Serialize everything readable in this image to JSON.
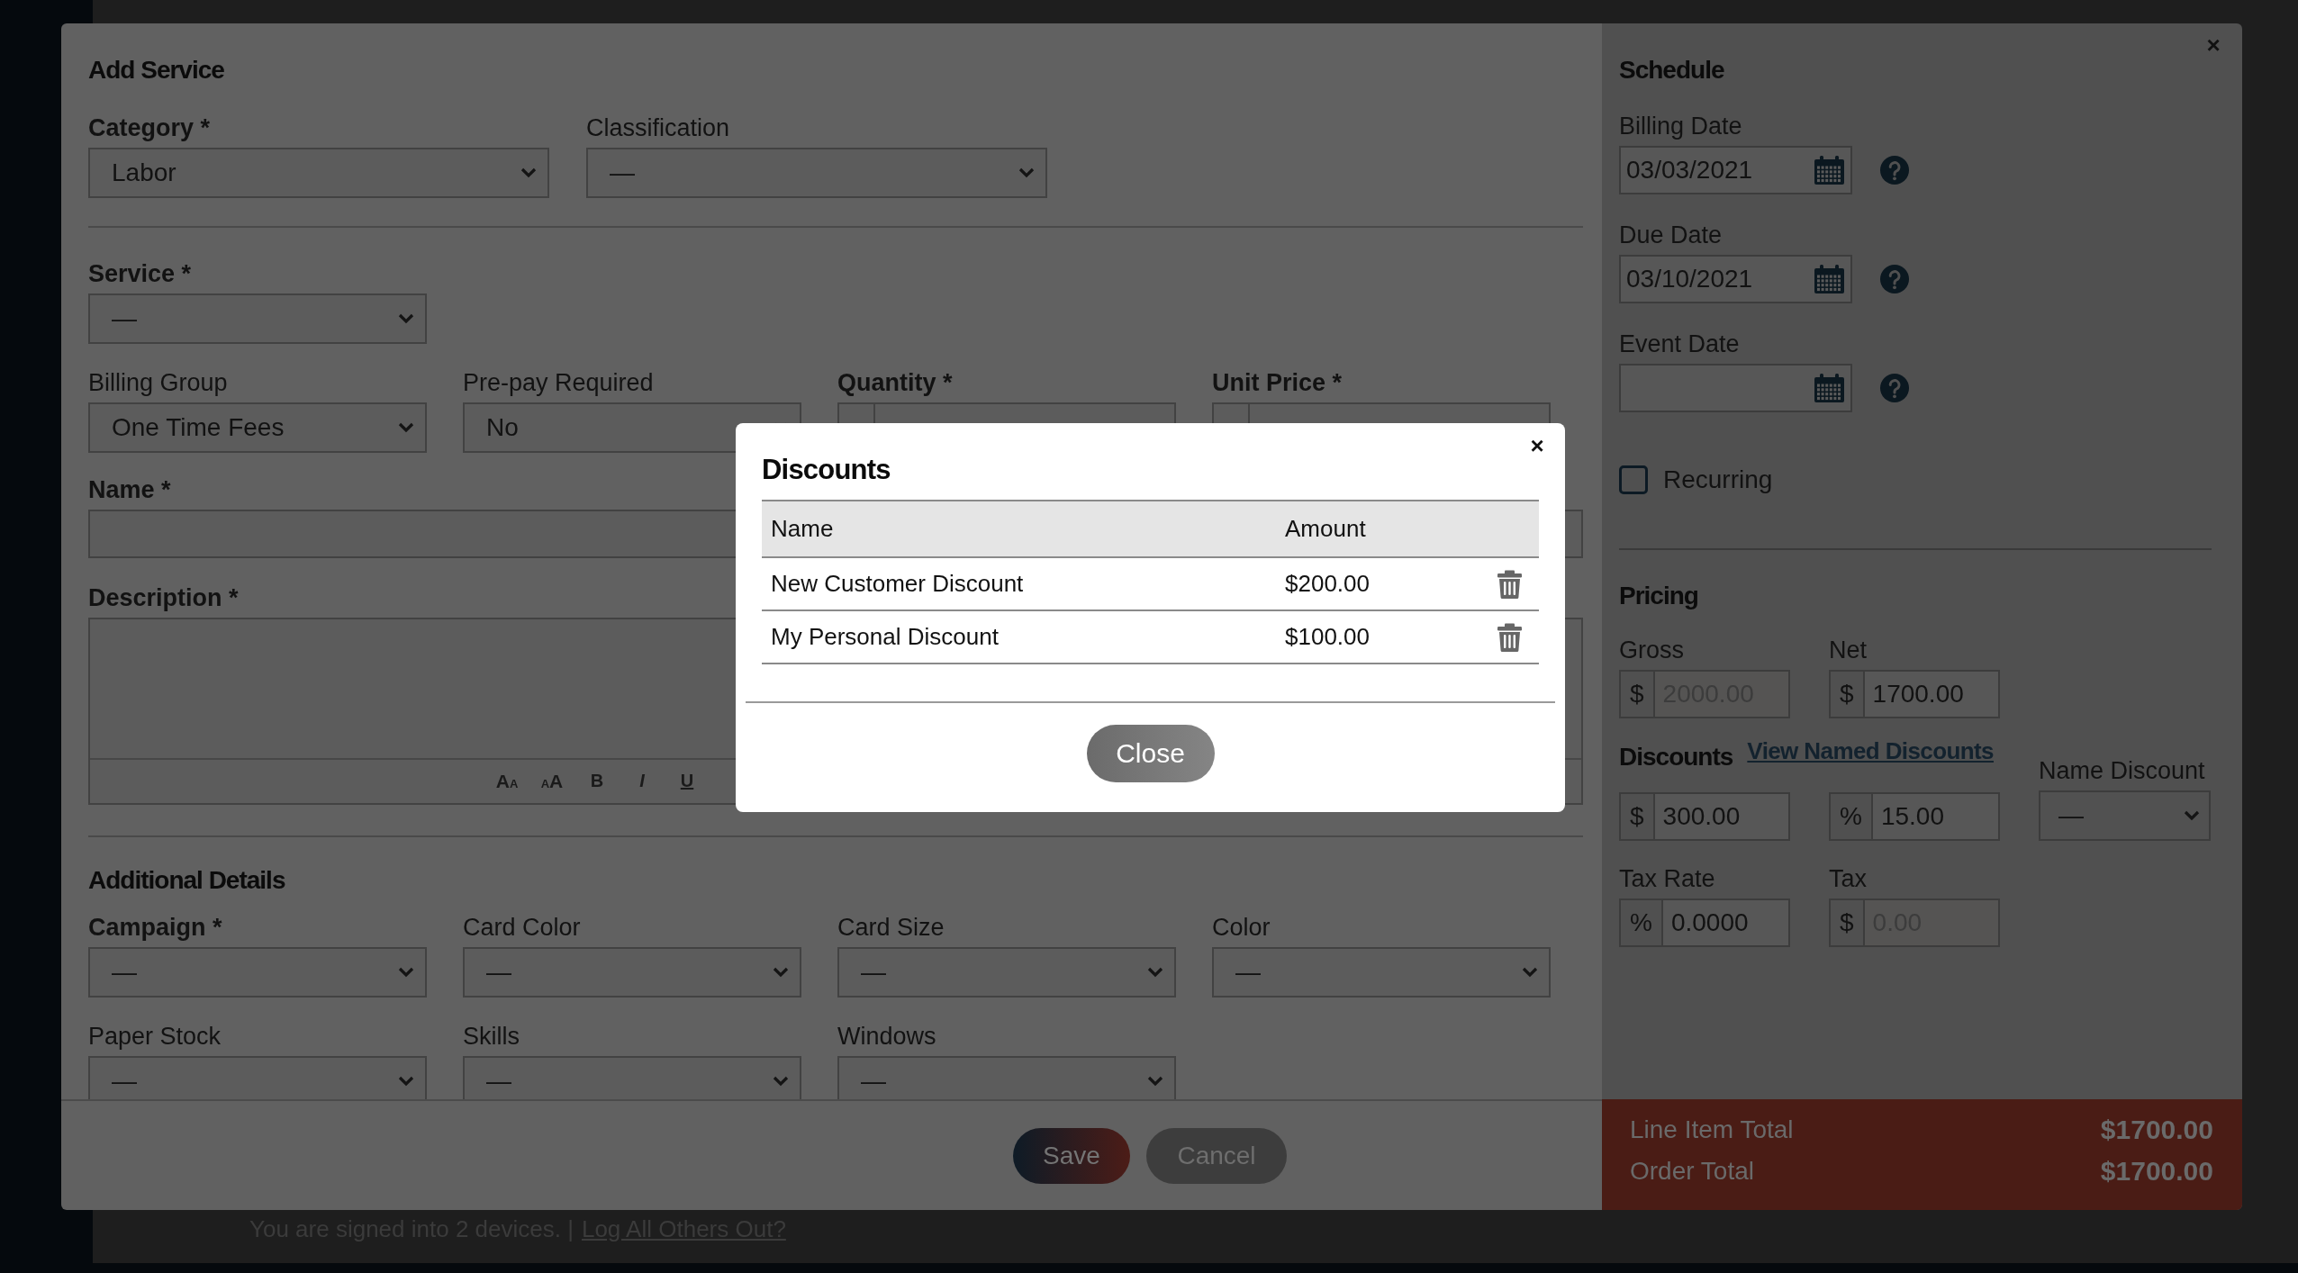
{
  "background": {
    "footer_text": "You are signed into 2 devices. |",
    "footer_link": "Log All Others Out?"
  },
  "add_service": {
    "title": "Add Service",
    "top_fields": [
      {
        "kind": "select",
        "label": "Category *",
        "required": true,
        "value": "Labor"
      },
      {
        "kind": "select",
        "label": "Classification",
        "required": false,
        "value": "—"
      }
    ],
    "service": {
      "kind": "select",
      "label": "Service *",
      "required": true,
      "value": "—"
    },
    "billing_fields": [
      {
        "kind": "select",
        "label": "Billing Group",
        "required": false,
        "value": "One Time Fees"
      },
      {
        "kind": "select",
        "label": "Pre-pay Required",
        "required": false,
        "value": "No"
      },
      {
        "kind": "number",
        "label": "Quantity *",
        "required": true
      },
      {
        "kind": "number",
        "label": "Unit Price *",
        "required": true
      }
    ],
    "name": {
      "label": "Name *",
      "required": true
    },
    "description": {
      "label": "Description *",
      "required": true,
      "toolbar": [
        {
          "kind": "shrink",
          "label": "A",
          "small": "A"
        },
        {
          "kind": "grow",
          "label": "A",
          "small": "A"
        },
        {
          "kind": "bold",
          "label": "B"
        },
        {
          "kind": "italic",
          "label": "I"
        },
        {
          "kind": "underline",
          "label": "U"
        }
      ]
    },
    "details_title": "Additional Details",
    "details_fields": [
      {
        "kind": "select",
        "label": "Campaign *",
        "required": true,
        "value": "—"
      },
      {
        "kind": "select",
        "label": "Card Color",
        "required": false,
        "value": "—"
      },
      {
        "kind": "select",
        "label": "Card Size",
        "required": false,
        "value": "—"
      },
      {
        "kind": "select",
        "label": "Color",
        "required": false,
        "value": "—"
      },
      {
        "kind": "select",
        "label": "Paper Stock",
        "required": false,
        "value": "—"
      },
      {
        "kind": "select",
        "label": "Skills",
        "required": false,
        "value": "—"
      },
      {
        "kind": "select",
        "label": "Windows",
        "required": false,
        "value": "—"
      }
    ],
    "buttons": [
      {
        "kind": "primary",
        "label": "Save"
      },
      {
        "kind": "secondary",
        "label": "Cancel"
      }
    ]
  },
  "schedule": {
    "close": "×",
    "title": "Schedule",
    "dates": [
      {
        "label": "Billing Date",
        "value": "03/03/2021"
      },
      {
        "label": "Due Date",
        "value": "03/10/2021"
      },
      {
        "label": "Event Date"
      }
    ],
    "recurring": {
      "label": "Recurring",
      "checked": false
    }
  },
  "pricing": {
    "title": "Pricing",
    "amounts": [
      {
        "label": "Gross",
        "prefix": "$",
        "value": "2000.00",
        "disabled": true
      },
      {
        "label": "Net",
        "prefix": "$",
        "value": "1700.00",
        "disabled": false
      }
    ],
    "discounts_title": "Discounts",
    "discounts_link": "View Named Discounts",
    "discount_fields": [
      {
        "prefix": "$",
        "value": "300.00",
        "disabled": false
      },
      {
        "prefix": "%",
        "value": "15.00",
        "disabled": false
      }
    ],
    "name_discount": {
      "label": "Name Discount",
      "value": "—"
    },
    "tax_fields": [
      {
        "label": "Tax Rate",
        "prefix": "%",
        "value": "0.0000",
        "disabled": false
      },
      {
        "label": "Tax",
        "prefix": "$",
        "value": "0.00",
        "disabled": true
      }
    ]
  },
  "totals": [
    {
      "label": "Line Item Total",
      "value": "$1700.00"
    },
    {
      "label": "Order Total",
      "value": "$1700.00"
    }
  ],
  "discounts_dialog": {
    "title": "Discounts",
    "close": "×",
    "columns": [
      "Name",
      "Amount"
    ],
    "rows": [
      {
        "name": "New Customer Discount",
        "amount": "$200.00"
      },
      {
        "name": "My Personal Discount",
        "amount": "$100.00"
      }
    ],
    "button": "Close"
  }
}
